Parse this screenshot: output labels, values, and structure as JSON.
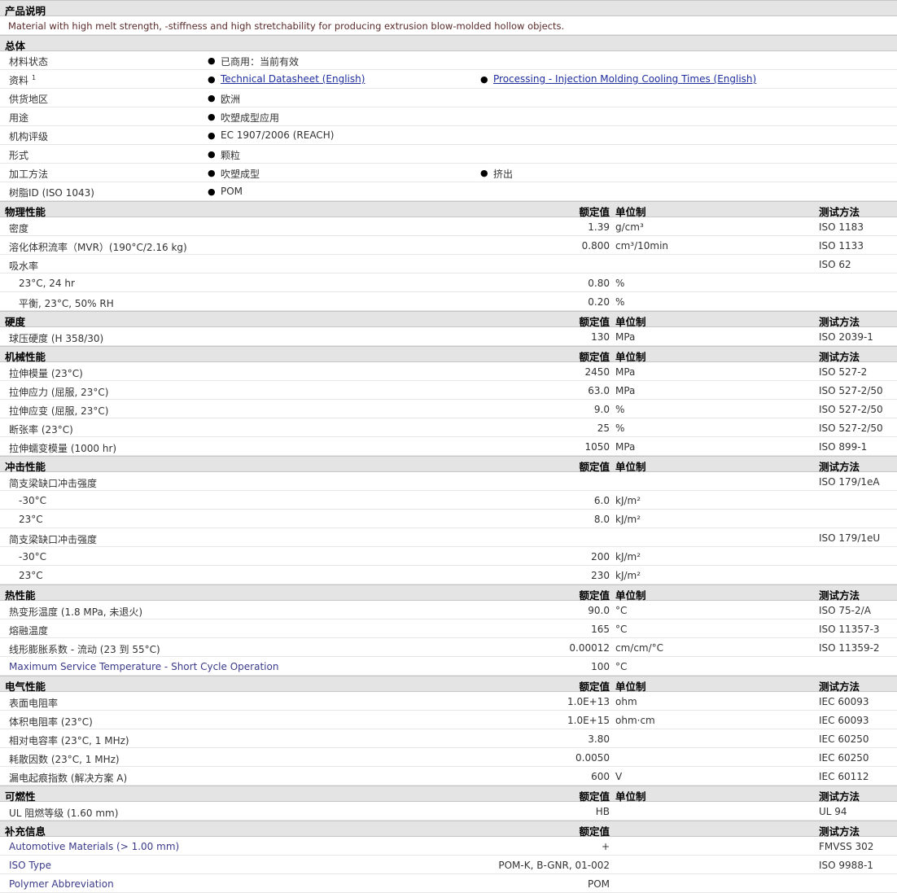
{
  "description": {
    "title": "产品说明",
    "text": "Material with high melt strength, -stiffness and high stretchability for producing extrusion blow-molded hollow objects."
  },
  "general": {
    "title": "总体",
    "rows": [
      {
        "label": "材料状态",
        "v1": "已商用：当前有效",
        "v2": ""
      },
      {
        "label": "资料",
        "sup": "1",
        "v1": "Technical Datasheet (English)",
        "v1_link": true,
        "v2": "Processing - Injection Molding Cooling Times (English)",
        "v2_link": true
      },
      {
        "label": "供货地区",
        "v1": "欧洲",
        "v2": ""
      },
      {
        "label": "用途",
        "v1": "吹塑成型应用",
        "v2": ""
      },
      {
        "label": "机构评级",
        "v1": "EC 1907/2006 (REACH)",
        "v2": ""
      },
      {
        "label": "形式",
        "v1": "颗粒",
        "v2": ""
      },
      {
        "label": "加工方法",
        "v1": "吹塑成型",
        "v2": "挤出"
      },
      {
        "label": "树脂ID (ISO 1043)",
        "v1": "POM",
        "v2": ""
      }
    ]
  },
  "columns": {
    "value": "额定值",
    "unit": "单位制",
    "method": "测试方法"
  },
  "sections": [
    {
      "title": "物理性能",
      "show_unit": true,
      "rows": [
        {
          "label": "密度",
          "value": "1.39",
          "unit": "g/cm³",
          "method": "ISO 1183"
        },
        {
          "label": "溶化体积流率（MVR）(190°C/2.16 kg)",
          "value": "0.800",
          "unit": "cm³/10min",
          "method": "ISO 1133"
        },
        {
          "label": "吸水率",
          "value": "",
          "unit": "",
          "method": "ISO 62"
        },
        {
          "label": "23°C, 24 hr",
          "indent": true,
          "value": "0.80",
          "unit": "%",
          "method": ""
        },
        {
          "label": "平衡, 23°C, 50% RH",
          "indent": true,
          "value": "0.20",
          "unit": "%",
          "method": ""
        }
      ]
    },
    {
      "title": "硬度",
      "show_unit": true,
      "rows": [
        {
          "label": "球压硬度 (H 358/30)",
          "value": "130",
          "unit": "MPa",
          "method": "ISO 2039-1"
        }
      ]
    },
    {
      "title": "机械性能",
      "show_unit": true,
      "rows": [
        {
          "label": "拉伸模量 (23°C)",
          "value": "2450",
          "unit": "MPa",
          "method": "ISO 527-2"
        },
        {
          "label": "拉伸应力 (屈服, 23°C)",
          "value": "63.0",
          "unit": "MPa",
          "method": "ISO 527-2/50"
        },
        {
          "label": "拉伸应变 (屈服, 23°C)",
          "value": "9.0",
          "unit": "%",
          "method": "ISO 527-2/50"
        },
        {
          "label": "断张率 (23°C)",
          "value": "25",
          "unit": "%",
          "method": "ISO 527-2/50"
        },
        {
          "label": "拉伸蠕变模量 (1000 hr)",
          "value": "1050",
          "unit": "MPa",
          "method": "ISO 899-1"
        }
      ]
    },
    {
      "title": "冲击性能",
      "show_unit": true,
      "rows": [
        {
          "label": "简支梁缺口冲击强度",
          "value": "",
          "unit": "",
          "method": "ISO 179/1eA"
        },
        {
          "label": "-30°C",
          "indent": true,
          "value": "6.0",
          "unit": "kJ/m²",
          "method": ""
        },
        {
          "label": "23°C",
          "indent": true,
          "value": "8.0",
          "unit": "kJ/m²",
          "method": ""
        },
        {
          "label": "简支梁缺口冲击强度",
          "value": "",
          "unit": "",
          "method": "ISO 179/1eU"
        },
        {
          "label": "-30°C",
          "indent": true,
          "value": "200",
          "unit": "kJ/m²",
          "method": ""
        },
        {
          "label": "23°C",
          "indent": true,
          "value": "230",
          "unit": "kJ/m²",
          "method": ""
        }
      ]
    },
    {
      "title": "热性能",
      "show_unit": true,
      "rows": [
        {
          "label": "热变形温度 (1.8 MPa, 未退火)",
          "value": "90.0",
          "unit": "°C",
          "method": "ISO 75-2/A"
        },
        {
          "label": "熔融温度",
          "value": "165",
          "unit": "°C",
          "method": "ISO 11357-3"
        },
        {
          "label": "线形膨胀系数 - 流动 (23 到 55°C)",
          "value": "0.00012",
          "unit": "cm/cm/°C",
          "method": "ISO 11359-2"
        },
        {
          "label": "Maximum Service Temperature - Short Cycle Operation",
          "en": true,
          "value": "100",
          "unit": "°C",
          "method": ""
        }
      ]
    },
    {
      "title": "电气性能",
      "show_unit": true,
      "rows": [
        {
          "label": "表面电阻率",
          "value": "1.0E+13",
          "unit": "ohm",
          "method": "IEC 60093"
        },
        {
          "label": "体积电阻率 (23°C)",
          "value": "1.0E+15",
          "unit": "ohm·cm",
          "method": "IEC 60093"
        },
        {
          "label": "相对电容率 (23°C, 1 MHz)",
          "value": "3.80",
          "unit": "",
          "method": "IEC 60250"
        },
        {
          "label": "耗散因数 (23°C, 1 MHz)",
          "value": "0.0050",
          "unit": "",
          "method": "IEC 60250"
        },
        {
          "label": "漏电起痕指数 (解决方案 A)",
          "value": "600",
          "unit": "V",
          "method": "IEC 60112"
        }
      ]
    },
    {
      "title": "可燃性",
      "show_unit": true,
      "rows": [
        {
          "label": "UL 阻燃等级 (1.60 mm)",
          "value": "HB",
          "unit": "",
          "method": "UL 94"
        }
      ]
    },
    {
      "title": "补充信息",
      "show_unit": false,
      "rows": [
        {
          "label": "Automotive Materials (> 1.00 mm)",
          "en": true,
          "value": "+",
          "unit": "",
          "method": "FMVSS 302"
        },
        {
          "label": "ISO Type",
          "en": true,
          "value": "POM-K, B-GNR, 01-002",
          "unit": "",
          "method": "ISO 9988-1"
        },
        {
          "label": "Polymer Abbreviation",
          "en": true,
          "value": "POM",
          "unit": "",
          "method": ""
        }
      ]
    }
  ]
}
